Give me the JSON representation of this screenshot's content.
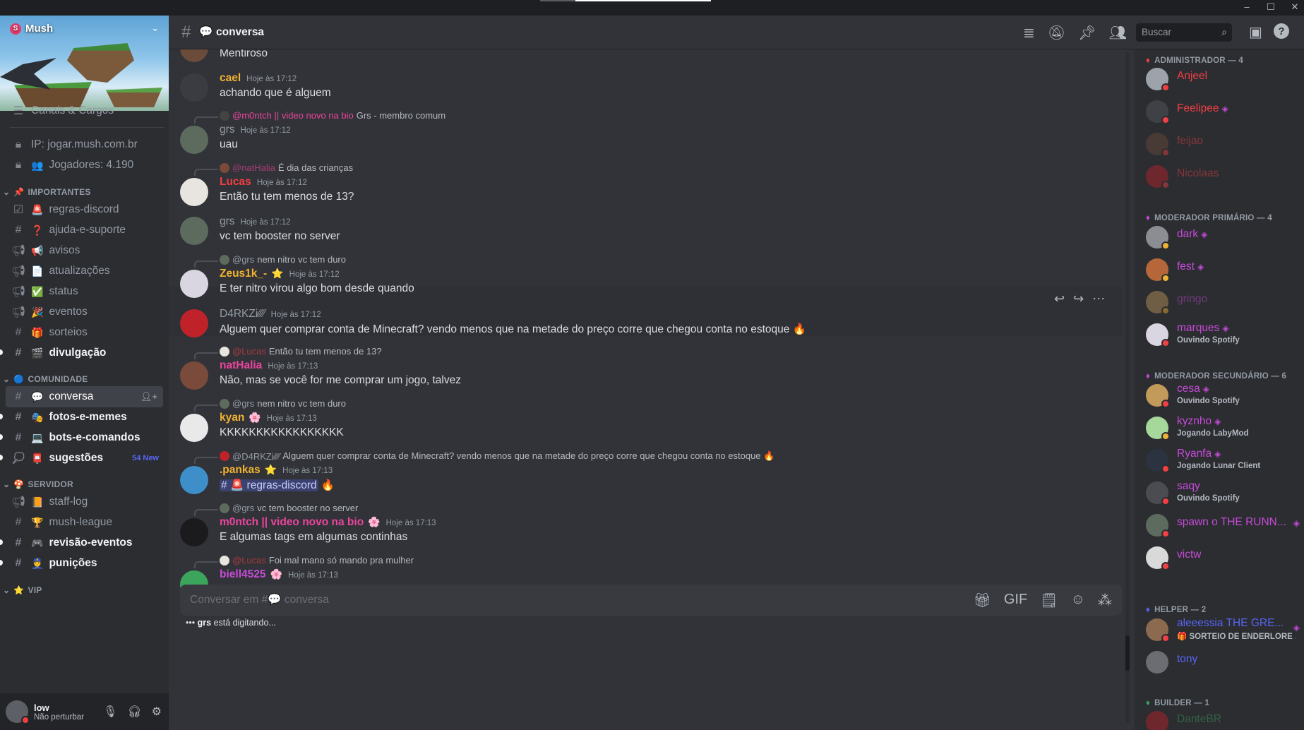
{
  "server": {
    "name": "Mush",
    "banner_alt": "server banner"
  },
  "sidebar": {
    "top_items": [
      {
        "label": "Canais & Cargos",
        "icon": "list-icon"
      },
      {
        "label": "IP: jogar.mush.com.br",
        "icon": "lock-icon"
      },
      {
        "label": "Jogadores: 4.190",
        "icon": "lock-icon"
      }
    ],
    "categories": [
      {
        "label": "IMPORTANTES",
        "emoji": "📌"
      },
      {
        "label": "COMUNIDADE",
        "emoji": "🔵"
      },
      {
        "label": "SERVIDOR",
        "emoji": "🍄"
      },
      {
        "label": "VIP",
        "emoji": "⭐"
      }
    ],
    "channels": [
      {
        "label": "regras-discord",
        "emoji": "🚨",
        "icon": "rules-icon"
      },
      {
        "label": "ajuda-e-suporte",
        "emoji": "❓",
        "icon": "hash-icon"
      },
      {
        "label": "avisos",
        "emoji": "📢",
        "icon": "megaphone-icon"
      },
      {
        "label": "atualizações",
        "emoji": "📄",
        "icon": "megaphone-icon"
      },
      {
        "label": "status",
        "emoji": "✅",
        "icon": "megaphone-icon"
      },
      {
        "label": "eventos",
        "emoji": "🎉",
        "icon": "megaphone-icon"
      },
      {
        "label": "sorteios",
        "emoji": "🎁",
        "icon": "hash-icon"
      },
      {
        "label": "divulgação",
        "emoji": "🎬",
        "icon": "hash-icon"
      },
      {
        "label": "conversa",
        "emoji": "💬",
        "icon": "hash-icon"
      },
      {
        "label": "fotos-e-memes",
        "emoji": "🎭",
        "icon": "hash-icon"
      },
      {
        "label": "bots-e-comandos",
        "emoji": "💻",
        "icon": "hash-icon"
      },
      {
        "label": "sugestões",
        "emoji": "📮",
        "icon": "forum-icon",
        "badge": "54 New"
      },
      {
        "label": "staff-log",
        "emoji": "📙",
        "icon": "megaphone-icon"
      },
      {
        "label": "mush-league",
        "emoji": "🏆",
        "icon": "hash-icon"
      },
      {
        "label": "revisão-eventos",
        "emoji": "🎮",
        "icon": "hash-icon"
      },
      {
        "label": "punições",
        "emoji": "👮",
        "icon": "hash-icon"
      }
    ]
  },
  "user": {
    "name": "low",
    "status": "Não perturbar"
  },
  "header": {
    "channel": "conversa",
    "channel_emoji": "💬",
    "search_placeholder": "Buscar"
  },
  "messages": [
    {
      "author": "",
      "time": "",
      "text": "Mentiroso"
    },
    {
      "author": "cael",
      "time": "Hoje às 17:12",
      "text": "achando que é alguem"
    },
    {
      "reply_to": "@m0ntch || video novo na bio",
      "reply_text": "Grs - membro comum",
      "author": "grs",
      "time": "Hoje às 17:12",
      "text": "uau"
    },
    {
      "reply_to": "@natHalia",
      "reply_text": "É dia das crianças",
      "author": "Lucas",
      "time": "Hoje às 17:12",
      "text": "Então tu tem menos de 13?"
    },
    {
      "author": "grs",
      "time": "Hoje às 17:12",
      "text": "vc tem booster no server"
    },
    {
      "reply_to": "@grs",
      "reply_text": "nem nitro vc tem duro",
      "author": "Zeus1k_-",
      "time": "Hoje às 17:12",
      "text": "E ter nitro virou algo bom desde quando"
    },
    {
      "author": "D4RKZi⁄⁄⁄⁄",
      "time": "Hoje às 17:12",
      "text": "Alguem quer comprar conta de Minecraft? vendo menos que na metade do preço corre que chegou conta no estoque 🔥"
    },
    {
      "reply_to": "@Lucas",
      "reply_text": "Então tu tem menos de 13?",
      "author": "natHalia",
      "time": "Hoje às 17:13",
      "text": "Não, mas se você for me comprar um jogo, talvez"
    },
    {
      "reply_to": "@grs",
      "reply_text": "nem nitro vc tem duro",
      "author": "kyan",
      "time": "Hoje às 17:13",
      "text": "KKKKKKKKKKKKKKKKK"
    },
    {
      "reply_to": "@D4RKZi⁄⁄⁄⁄",
      "reply_text": "Alguem quer comprar conta de Minecraft? vendo menos que na metade do preço corre que chegou conta no estoque 🔥",
      "author": ".pankas",
      "time": "Hoje às 17:13",
      "text_mention": "🚨 regras-discord",
      "text_suffix": "🔥"
    },
    {
      "reply_to": "@grs",
      "reply_text": "vc tem booster no server",
      "author": "m0ntch || video novo na bio",
      "time": "Hoje às 17:13",
      "text": "E algumas tags em algumas continhas"
    },
    {
      "reply_to": "@Lucas",
      "reply_text": "Foi mal mano só mando pra mulher",
      "author": "biell4525",
      "time": "Hoje às 17:13",
      "text": ""
    }
  ],
  "composer": {
    "placeholder": "Conversar em #💬 conversa"
  },
  "typing": {
    "user": "grs",
    "text": "está digitando..."
  },
  "roles": [
    {
      "label": "ADMINISTRADOR — 4"
    },
    {
      "label": "MODERADOR PRIMÁRIO — 4"
    },
    {
      "label": "MODERADOR SECUNDÁRIO — 6"
    },
    {
      "label": "HELPER — 2"
    },
    {
      "label": "BUILDER — 1"
    }
  ],
  "members": [
    {
      "name": "Anjeel",
      "activity": ""
    },
    {
      "name": "Feelipee",
      "activity": ""
    },
    {
      "name": "feijao",
      "activity": ""
    },
    {
      "name": "Nicolaas",
      "activity": ""
    },
    {
      "name": "dark",
      "activity": ""
    },
    {
      "name": "fest",
      "activity": ""
    },
    {
      "name": "gringo",
      "activity": ""
    },
    {
      "name": "marques",
      "activity": "Ouvindo Spotify"
    },
    {
      "name": "cesa",
      "activity": "Ouvindo Spotify"
    },
    {
      "name": "kyznho",
      "activity": "Jogando LabyMod"
    },
    {
      "name": "Ryanfa",
      "activity": "Jogando Lunar Client"
    },
    {
      "name": "saqy",
      "activity": "Ouvindo Spotify"
    },
    {
      "name": "spawn o THE RUNN...",
      "activity": ""
    },
    {
      "name": "victw",
      "activity": ""
    },
    {
      "name": "aleeessia THE GRE...",
      "activity": "🎁 SORTEIO DE ENDERLORE ..."
    },
    {
      "name": "tony",
      "activity": ""
    },
    {
      "name": "DanteBR",
      "activity": ""
    }
  ],
  "colors": {
    "admin": "#f23f43",
    "mod_primary": "#c74bd8",
    "mod_secondary": "#c74bd8",
    "helper": "#5865f2",
    "builder": "#3ba55c",
    "cael": "#f0b232",
    "lucas": "#f23f43",
    "zeus": "#f0b232",
    "nathalia": "#eb459e",
    "kyan": "#f0b232",
    "pankas": "#f0b232",
    "montch": "#eb459e",
    "biell": "#c74bd8"
  }
}
